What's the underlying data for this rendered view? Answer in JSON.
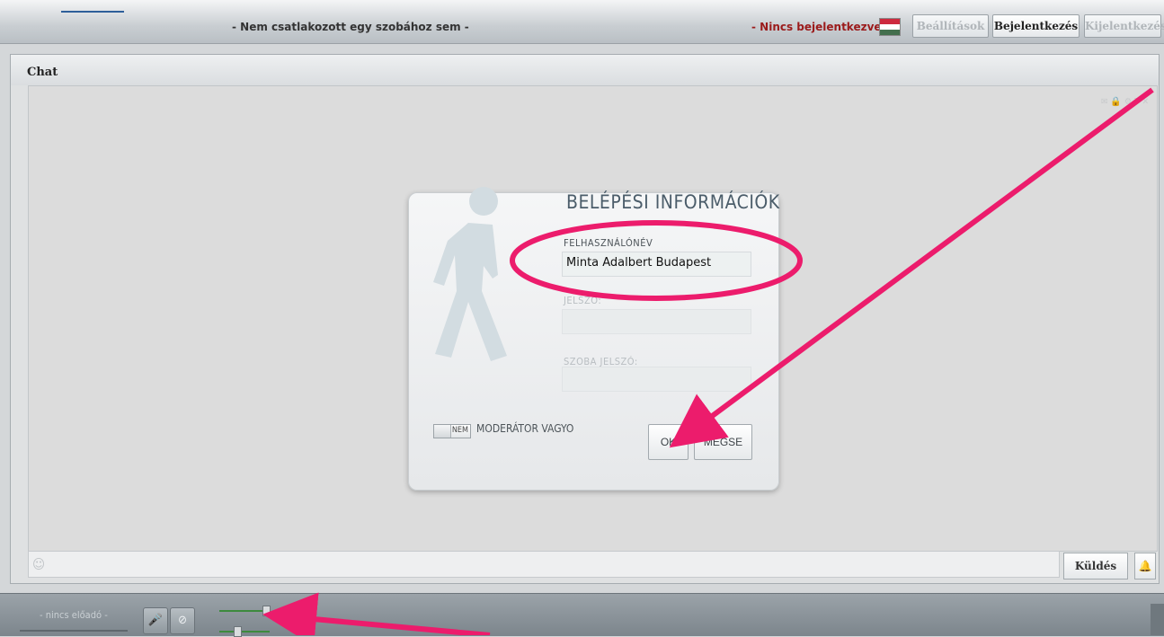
{
  "header": {
    "room_status": "- Nem csatlakozott egy szobához sem -",
    "login_status": "- Nincs bejelentkezve -",
    "buttons": {
      "settings": "Beállítások",
      "login": "Bejelentkezés",
      "logout": "Kijelentkezés"
    },
    "flag_colors": [
      "#cd2a3e",
      "#ffffff",
      "#436f4d"
    ]
  },
  "chat": {
    "title": "Chat",
    "toolbar_icons": [
      "email-icon",
      "lock-icon",
      "settings-icon",
      "font-size-icon",
      "close-icon"
    ],
    "send_label": "Küldés"
  },
  "dialog": {
    "title": "BELÉPÉSI INFORMÁCIÓK",
    "username_label": "FELHASZNÁLÓNÉV",
    "username_value": "Minta Adalbert Budapest",
    "password_label": "JELSZÓ:",
    "room_password_label": "SZOBA JELSZÓ:",
    "toggle_value": "NEM",
    "moderator_label": "MODERÁTOR VAGYO",
    "ok_label": "OK",
    "cancel_label": "MÉGSE"
  },
  "footer": {
    "presenter": "- nincs előadó -"
  },
  "colors": {
    "annotation": "#ec1c6c",
    "login_status": "#9b1b1b"
  }
}
